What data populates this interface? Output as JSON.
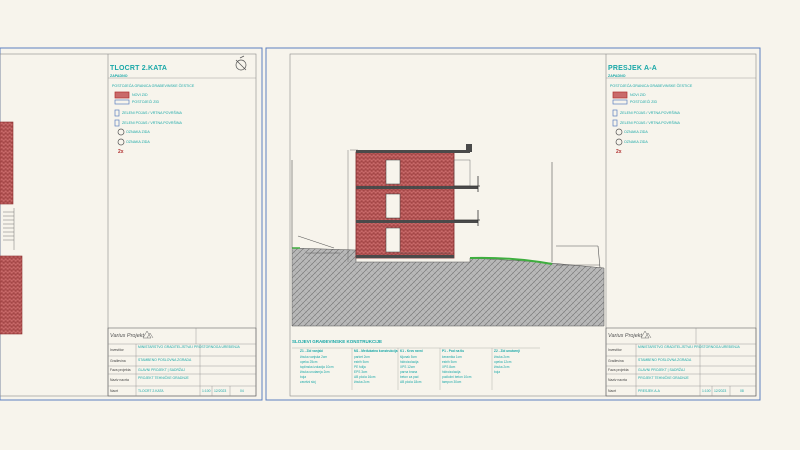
{
  "floor_sheet": {
    "title": "TLOCRT 2.KATA",
    "legend_heading": "ZAPADNO",
    "legend_items": [
      "POSTOJEĆA GRANICA GRAĐEVINSKE ČESTICE",
      "NOVI ZID",
      "POSTOJEĆI ZID",
      "ZELENI POJAS / VRTNA POVRŠINA",
      "ZELENI POJAS / VRTNA POVRŠINA",
      "ZELENI POJAS / VRTNA POVRŠINA",
      "OZNAKA ZIDA",
      "OZNAKA ZIDA"
    ],
    "scale_marker": "2x",
    "north_symbol": "north-arrow-icon",
    "title_block": {
      "company": "Varius Projekt",
      "rows": [
        {
          "label": "Investitor",
          "value": "MINISTARSTVO GRADITELJSTVA I PROSTORNOGA UREĐENJA"
        },
        {
          "label": "Građevina",
          "value": "STAMBENO POSLOVNA ZGRADA"
        },
        {
          "label": "Faza projekta",
          "value": "GLAVNI PROJEKT | SADRŽAJ"
        },
        {
          "label": "Naziv nacrta",
          "value": "PROJEKT TEHNIČKE GRADNJE"
        },
        {
          "label": "Nacrt",
          "value": "TLOCRT 2.KATA"
        }
      ],
      "sheet_no": "1:100",
      "date": "12/2023",
      "number": "04"
    }
  },
  "section_sheet": {
    "title": "PRESJEK A-A",
    "legend_heading": "ZAPADNO",
    "legend_items": [
      "POSTOJEĆA GRANICA GRAĐEVINSKE ČESTICE",
      "NOVI ZID",
      "POSTOJEĆI ZID",
      "ZELENI POJAS / VRTNA POVRŠINA",
      "ZELENI POJAS / VRTNA POVRŠINA",
      "ZELENI POJAS / VRTNA POVRŠINA",
      "OZNAKA ZIDA",
      "OZNAKA ZIDA"
    ],
    "scale_marker": "2x",
    "notes_title": "SLOJEVI GRAĐEVINSKE KONSTRUKCIJE",
    "note_columns": [
      {
        "heading": "Z1 - Zid vanjski",
        "lines": [
          "žbuka vanjska 2cm",
          "opeka 25cm",
          "toplinska izolacija 10cm",
          "žbuka unutarnja 2cm",
          "boja",
          "završni sloj"
        ]
      },
      {
        "heading": "M1 - Međukatna konstrukcija",
        "lines": [
          "parket 2cm",
          "estrih 5cm",
          "PE folija",
          "EPS 3cm",
          "AB ploča 16cm",
          "žbuka 2cm"
        ]
      },
      {
        "heading": "K1 - Krov ravni",
        "lines": [
          "šljunak 5cm",
          "hidroizolacija",
          "XPS 12cm",
          "parna brana",
          "beton za pad",
          "AB ploča 18cm"
        ]
      },
      {
        "heading": "P1 - Pod na tlu",
        "lines": [
          "keramika 1cm",
          "estrih 5cm",
          "XPS 8cm",
          "hidroizolacija",
          "podložni beton 10cm",
          "tampon 30cm"
        ]
      },
      {
        "heading": "Z2 - Zid unutarnji",
        "lines": [
          "žbuka 2cm",
          "opeka 12cm",
          "žbuka 2cm",
          "boja"
        ]
      }
    ],
    "title_block": {
      "company": "Varius Projekt",
      "rows": [
        {
          "label": "Investitor",
          "value": "MINISTARSTVO GRADITELJSTVA I PROSTORNOGA UREĐENJA"
        },
        {
          "label": "Građevina",
          "value": "STAMBENO POSLOVNA ZGRADA"
        },
        {
          "label": "Faza projekta",
          "value": "GLAVNI PROJEKT | SADRŽAJ"
        },
        {
          "label": "Naziv nacrta",
          "value": "PROJEKT TEHNIČKE GRADNJE"
        },
        {
          "label": "Nacrt",
          "value": "PRESJEK A-A"
        }
      ],
      "sheet_no": "1:100",
      "date": "12/2023",
      "number": "08"
    }
  },
  "colors": {
    "background": "#f7f4ec",
    "frame": "#5c7fc0",
    "accent": "#1aa8a8",
    "brick": "#b04848",
    "ground": "#9a9a9a",
    "grass": "#3fae3f"
  }
}
